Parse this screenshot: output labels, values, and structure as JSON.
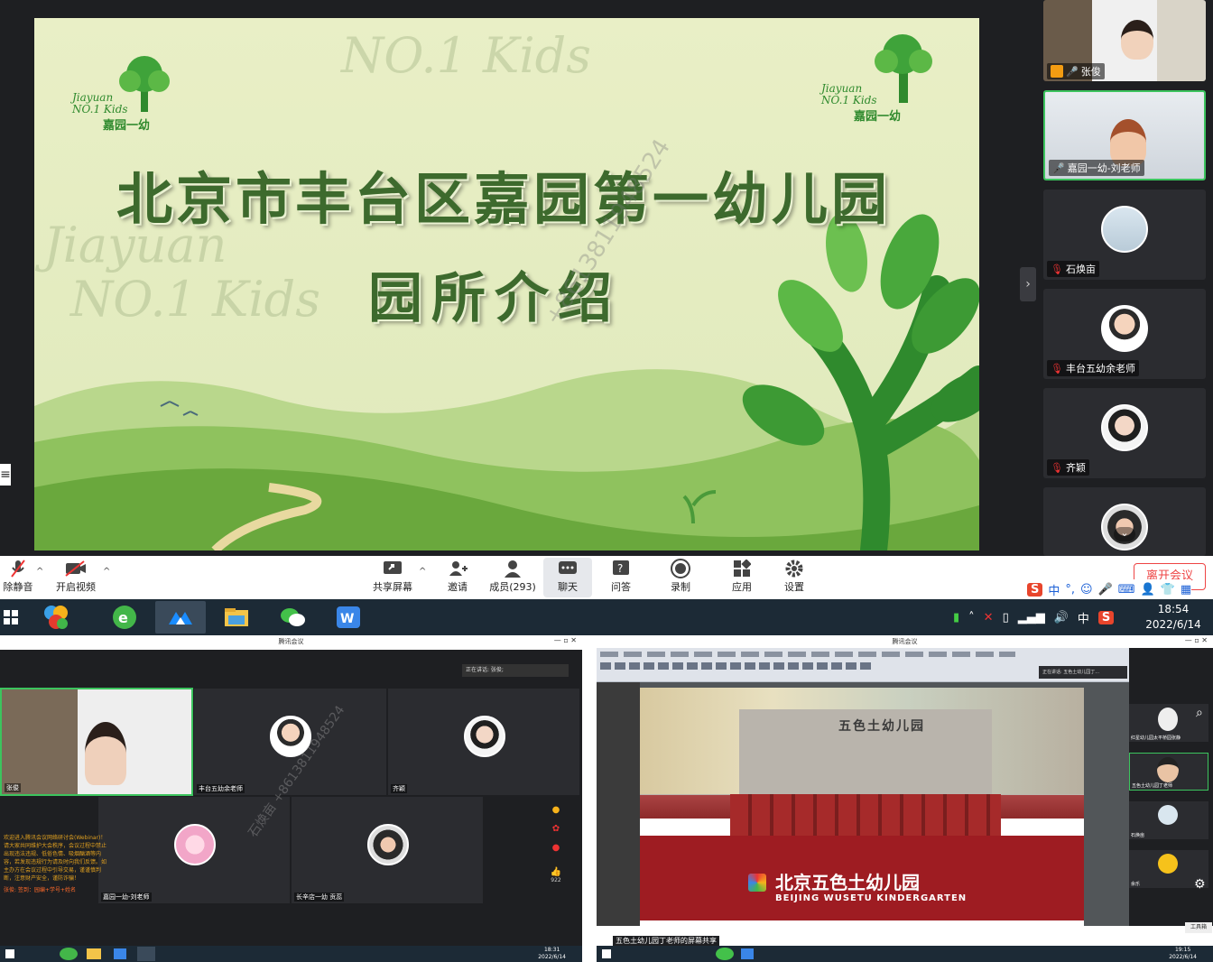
{
  "slide": {
    "title": "北京市丰台区嘉园第一幼儿园",
    "subtitle": "园所介绍",
    "logo_en_1": "Jiayuan",
    "logo_en_2": "NO.1 Kids",
    "logo_cn": "嘉园一幼",
    "watermark": "+8613811948524"
  },
  "participants": [
    {
      "name": "张俊",
      "status": "camera"
    },
    {
      "name": "嘉园一幼-刘老师",
      "status": "camera-active"
    },
    {
      "name": "石焕亩",
      "status": "avatar"
    },
    {
      "name": "丰台五幼余老师",
      "status": "avatar"
    },
    {
      "name": "齐颖",
      "status": "avatar"
    },
    {
      "name": "",
      "status": "avatar"
    }
  ],
  "toolbar": {
    "mute": "除静音",
    "video": "开启视频",
    "share": "共享屏幕",
    "invite": "邀请",
    "members": "成员(293)",
    "chat": "聊天",
    "qa": "问答",
    "record": "录制",
    "apps": "应用",
    "settings": "设置",
    "leave": "离开会议"
  },
  "ime": {
    "lang": "中"
  },
  "taskbar": {
    "time": "18:54",
    "date": "2022/6/14",
    "ime": "中"
  },
  "shot1": {
    "title": "腾讯会议",
    "speaking": "正在讲话: 张俊;",
    "tiles": [
      "张俊",
      "丰台五幼余老师",
      "齐颖",
      "嘉园一幼-刘老师",
      "长辛店一幼 贡蕊"
    ],
    "chat_lines": [
      "欢迎进入腾讯会议网络研讨会(Webinar)！",
      "请大家共同维护大会秩序，会议过程中禁止",
      "出现违法违规、低俗色情、吸烟酗酒等内",
      "容，若发现违规行为请及时向我们反馈。如",
      "主办方在会议过程中引导交易，谨谨慎判",
      "断，注意财产安全，谨防诈骗！",
      "张俊: 签到：园编+学号+姓名"
    ],
    "like_count": "922",
    "clock_time": "18:31",
    "clock_date": "2022/6/14",
    "watermark": "石焕亩 +8613811948524"
  },
  "shot2": {
    "title": "腾讯会议",
    "speaking": "正在讲话: 五色土幼儿园丁...",
    "sign_cn": "五色土幼儿园",
    "banner_cn": "北京五色土幼儿园",
    "banner_en": "BEIJING WUSETU KINDERGARTEN",
    "side_tiles": [
      "红星幼儿园太平桥园张静",
      "五色土幼儿园丁老师",
      "石焕亩",
      "余乐"
    ],
    "caption": "五色土幼儿园丁老师的屏幕共享",
    "work_label": "工具箱",
    "clock_time": "19:15",
    "clock_date": "2022/6/14"
  },
  "colors": {
    "slide_green": "#3d6a2d",
    "active_border": "#3cc45e",
    "leave_red": "#ee4444",
    "taskbar": "#1c2a36"
  }
}
